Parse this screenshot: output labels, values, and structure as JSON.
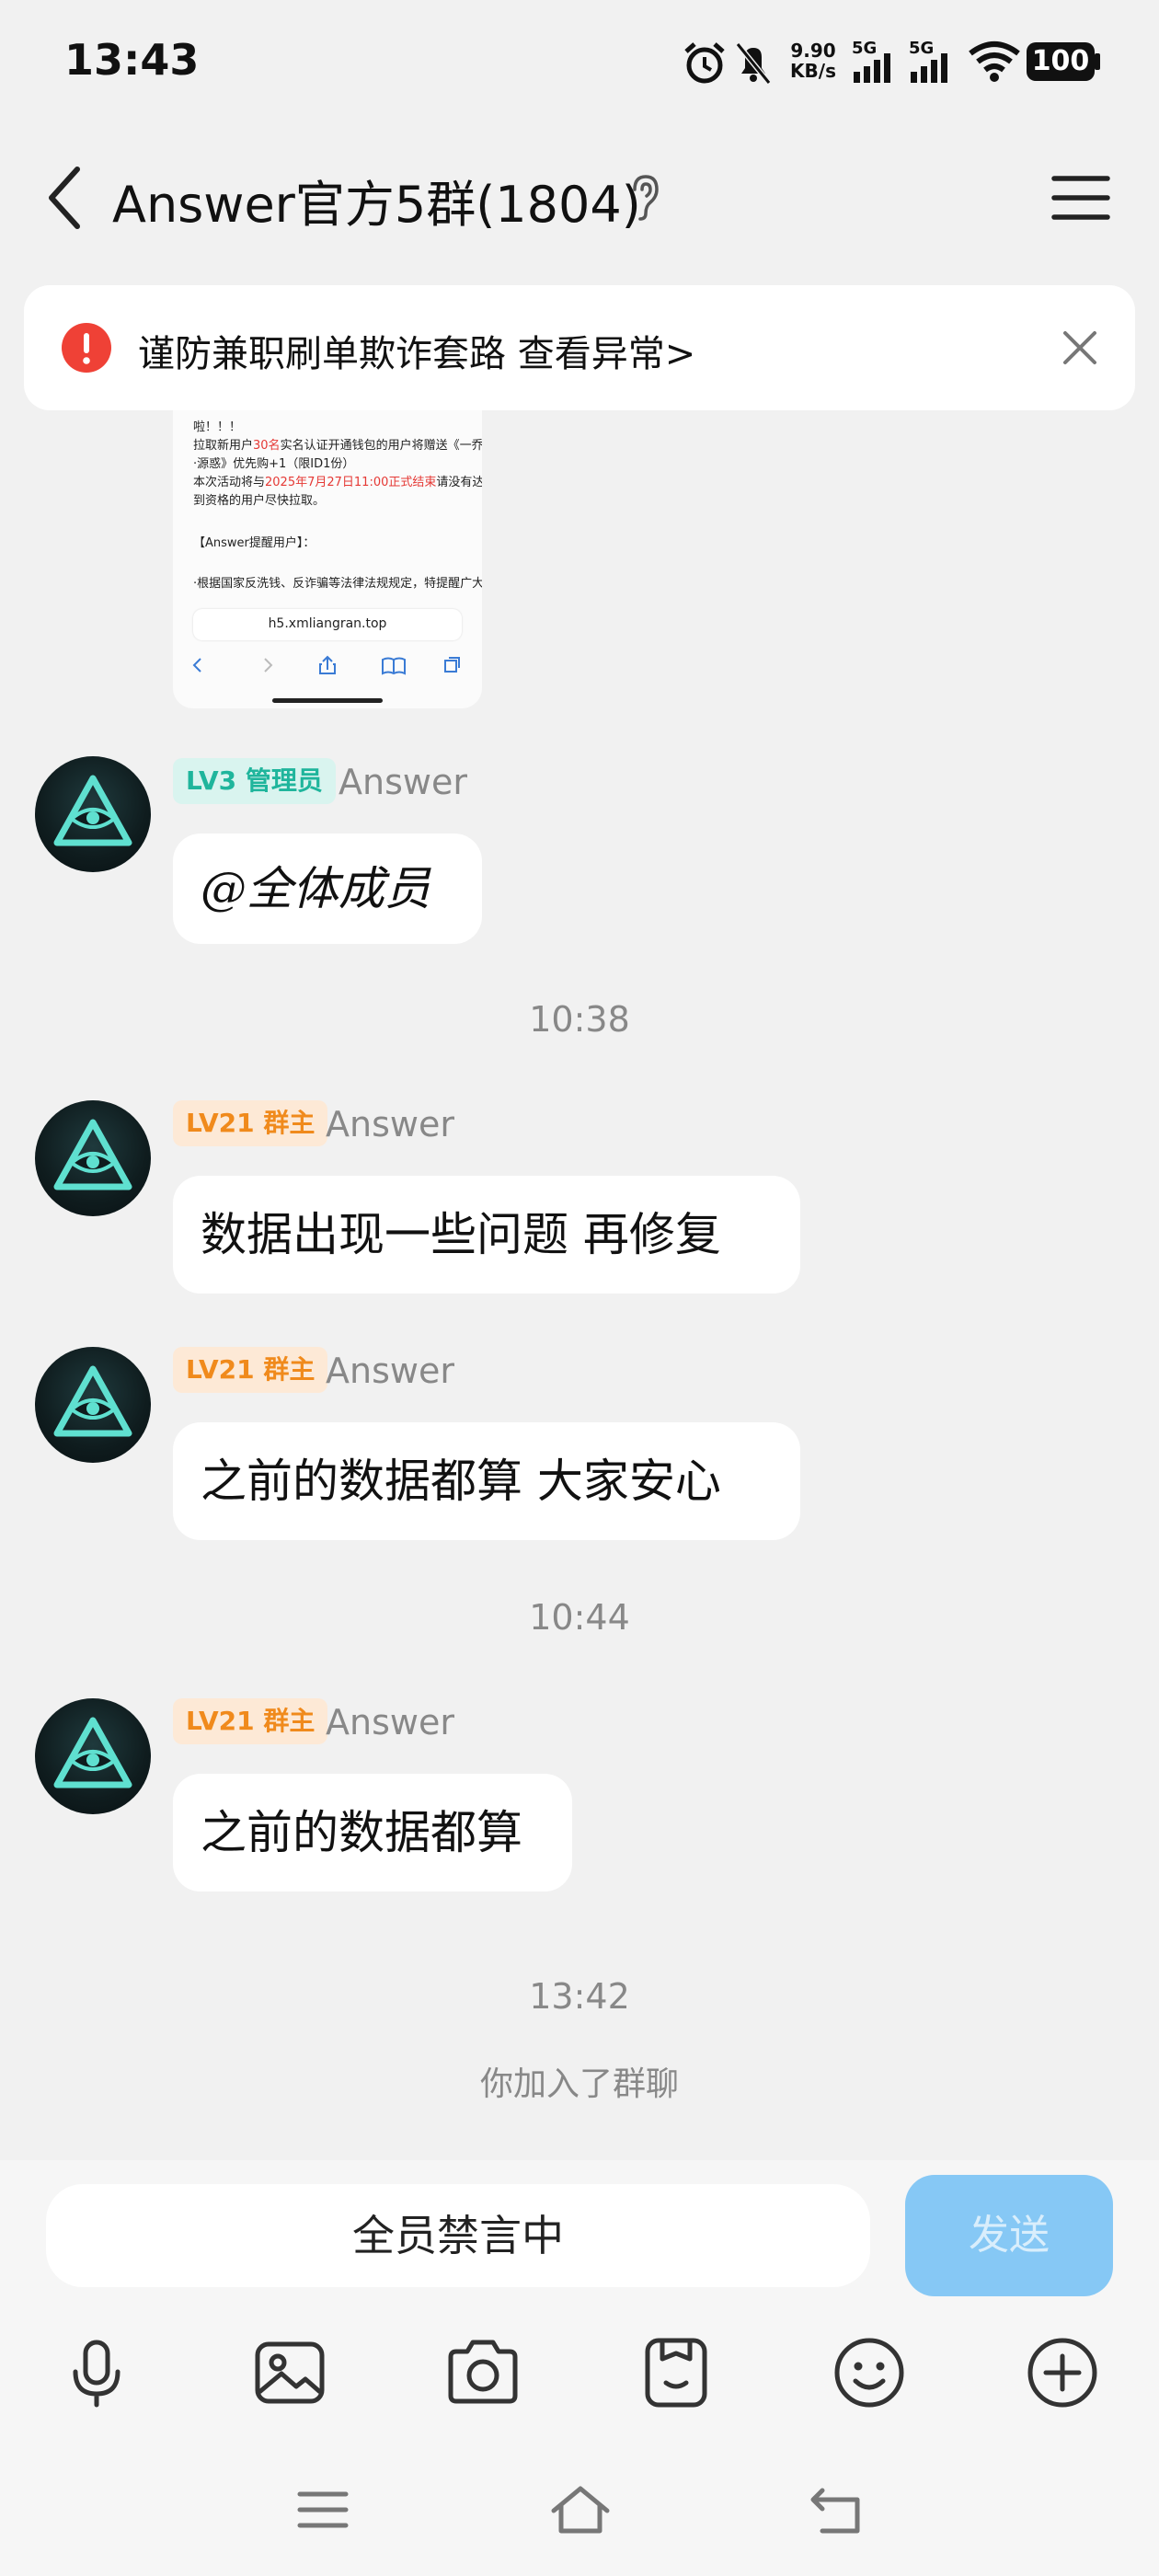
{
  "status_bar": {
    "time": "13:43",
    "net_speed_value": "9.90",
    "net_speed_unit": "KB/s",
    "signal1": "5G",
    "signal2": "5G",
    "battery": "100"
  },
  "header": {
    "title": "Answer官方5群(1804)"
  },
  "banner": {
    "text": "谨防兼职刷单欺诈套路 查看异常>"
  },
  "shared_image": {
    "lines": [
      "啦！！！",
      "拉取新用户30名实名认证开通钱包的用户将赠送《一乔",
      "·源惑》优先购+1（限ID1份）",
      "本次活动将与2025年7月27日11:00正式结束请没有达",
      "到资格的用户尽快拉取。",
      "【Answer提醒用户】：",
      "·根据国家反洗钱、反诈骗等法律法规规定，特提醒广大"
    ],
    "url": "h5.xmliangran.top"
  },
  "messages": [
    {
      "badge": "LV3 管理员",
      "sender": "Answer",
      "text": "@全体成员"
    },
    {
      "badge": "LV21 群主",
      "sender": "Answer",
      "text": "数据出现一些问题  再修复"
    },
    {
      "badge": "LV21 群主",
      "sender": "Answer",
      "text": "之前的数据都算  大家安心"
    },
    {
      "badge": "LV21 群主",
      "sender": "Answer",
      "text": "之前的数据都算"
    }
  ],
  "timestamps": [
    "10:38",
    "10:44",
    "13:42"
  ],
  "system_note": "你加入了群聊",
  "input": {
    "text": "全员禁言中",
    "send_label": "发送"
  },
  "colors": {
    "admin_badge": "#1fb59c",
    "owner_badge": "#f08a1c",
    "send_button": "#86c8f5",
    "alert": "#ef4136"
  },
  "icons": {
    "toolbar": [
      "microphone-icon",
      "image-icon",
      "camera-icon",
      "sticker-icon",
      "emoji-icon",
      "plus-icon"
    ],
    "navigation": [
      "menu-icon",
      "home-icon",
      "back-icon"
    ]
  }
}
